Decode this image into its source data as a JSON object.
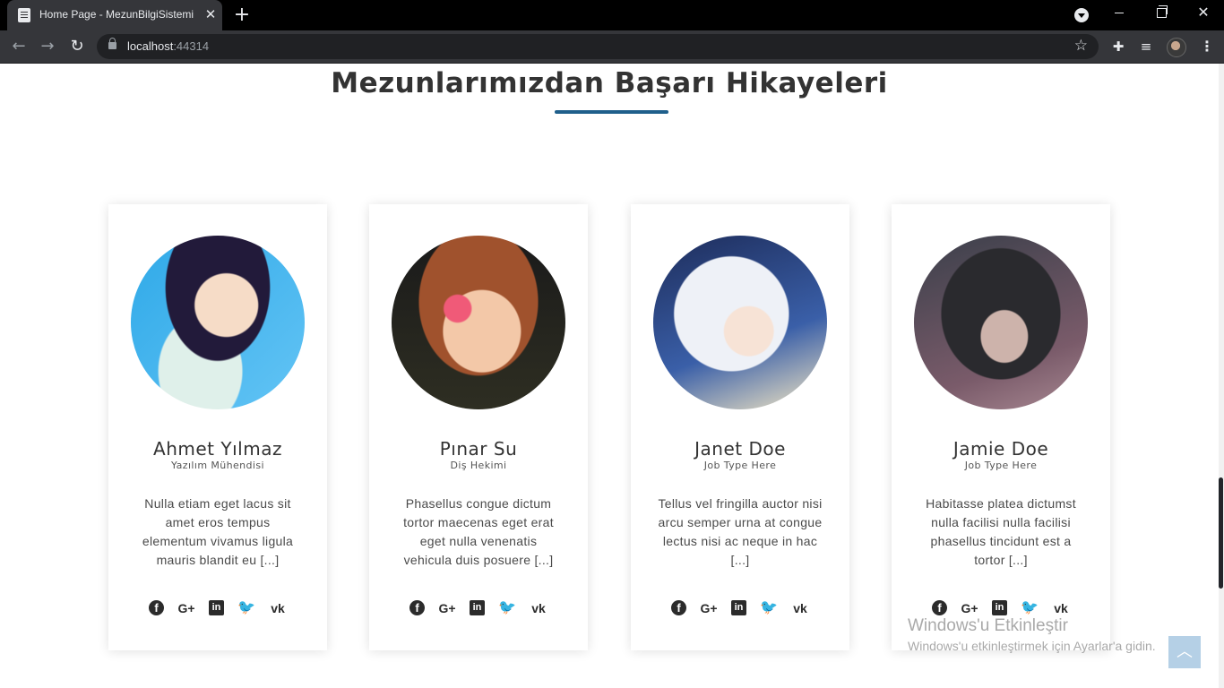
{
  "browser": {
    "tab_title": "Home Page - MezunBilgiSistemi",
    "tab_close": "✕",
    "new_tab": "+",
    "url_host": "localhost",
    "url_port": ":44314",
    "icons": {
      "back": "←",
      "forward": "→",
      "reload": "↻",
      "star": "☆",
      "extensions": "✚",
      "media": "≡",
      "menu": "⋮",
      "close": "✕"
    }
  },
  "section": {
    "title": "Mezunlarımızdan Başarı Hikayeleri",
    "accent_color": "#1f5f8b"
  },
  "cards": [
    {
      "name": "Ahmet Yılmaz",
      "job": "Yazılım Mühendisi",
      "text": "Nulla etiam eget lacus sit amet eros tempus elementum vivamus ligula mauris blandit eu [...]"
    },
    {
      "name": "Pınar Su",
      "job": "Diş Hekimi",
      "text": "Phasellus congue dictum tortor maecenas eget erat eget nulla venenatis vehicula duis posuere [...]"
    },
    {
      "name": "Janet Doe",
      "job": "Job Type Here",
      "text": "Tellus vel fringilla auctor nisi arcu semper urna at congue lectus nisi ac neque in hac [...]"
    },
    {
      "name": "Jamie Doe",
      "job": "Job Type Here",
      "text": "Habitasse platea dictumst nulla facilisi nulla facilisi phasellus tincidunt est a tortor [...]"
    }
  ],
  "social_glyphs": {
    "facebook": "f",
    "google_plus": "G+",
    "linkedin": "in",
    "twitter": "🐦",
    "vk": "vk"
  },
  "watermark": {
    "line1": "Windows'u Etkinleştir",
    "line2": "Windows'u etkinleştirmek için Ayarlar'a gidin."
  },
  "back_to_top": "︿"
}
